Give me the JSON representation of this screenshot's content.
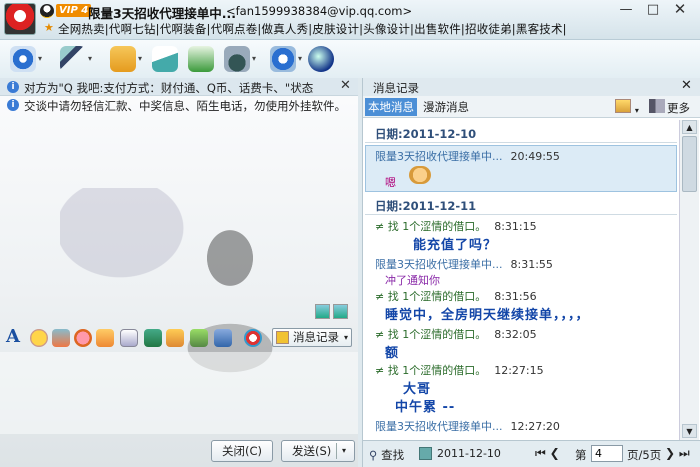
{
  "window": {
    "vip": "VIP 4",
    "title": "限量3天招收代理接单中...",
    "email": "<fan1599938384@vip.qq.com>",
    "signature": "全网热卖|代啊七钻|代啊装备|代啊点卷|做真人秀|皮肤设计|头像设计|出售软件|招收徒弟|黑客技术|",
    "min": "—",
    "max": "□",
    "close": "✕"
  },
  "notices": {
    "first": "对方为\"Q 我吧:支付方式：财付通、Q币、话费卡、\"状态",
    "second": "交谈中请勿轻信汇款、中奖信息、陌生电话，勿使用外挂软件。",
    "close": "✕"
  },
  "format": {
    "font_glyph": "A",
    "history_label": "消息记录",
    "dropdown": "▾"
  },
  "buttons": {
    "close": "关闭(C)",
    "send": "发送(S)",
    "send_dropdown": "▾"
  },
  "history": {
    "title": "消息记录",
    "close": "✕",
    "tab_local": "本地消息",
    "tab_roam": "漫游消息",
    "more": "更多",
    "date1": "日期:2011-12-10",
    "date2": "日期:2011-12-11",
    "messages": [
      {
        "sender": "限量3天招收代理接单中...",
        "time": "20:49:55",
        "text": "嗯"
      },
      {
        "sender": "≠  找 1个涩情的借口。",
        "time": "8:31:15",
        "text": "能充值了吗？"
      },
      {
        "sender": "限量3天招收代理接单中...",
        "time": "8:31:55",
        "text": "冲了通知你"
      },
      {
        "sender": "≠  找 1个涩情的借口。",
        "time": "8:31:56",
        "text": "睡觉中，全房明天继续接单，，，，"
      },
      {
        "sender": "≠  找 1个涩情的借口。",
        "time": "8:32:05",
        "text": "额"
      },
      {
        "sender": "≠  找 1个涩情的借口。",
        "time": "12:27:15",
        "text": "大哥"
      },
      {
        "sender": "",
        "time": "",
        "text": "中午累    --"
      },
      {
        "sender": "限量3天招收代理接单中...",
        "time": "12:27:20",
        "text": ""
      }
    ],
    "footer": {
      "search": "查找",
      "date": "2011-12-10",
      "first": "⏮",
      "prev": "❮",
      "page_label": "第",
      "page_value": "4",
      "page_total": "页/5页",
      "next": "❯",
      "last": "⏭"
    }
  }
}
